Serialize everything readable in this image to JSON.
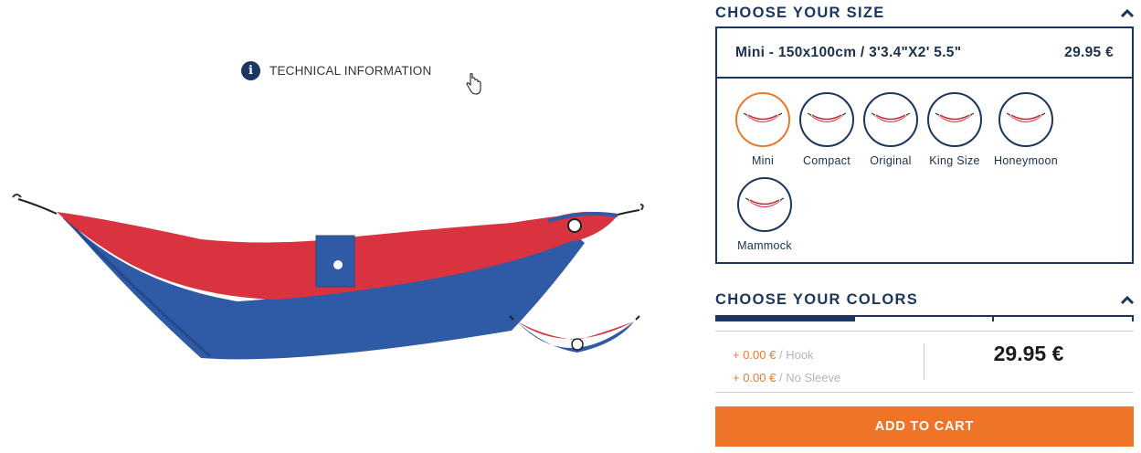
{
  "tech_info": {
    "label": "TECHNICAL INFORMATION",
    "icon": "info-icon"
  },
  "size_section": {
    "title": "CHOOSE YOUR SIZE",
    "selected": {
      "name": "Mini - 150x100cm / 3'3.4\"X2' 5.5\"",
      "price": "29.95 €"
    },
    "options": [
      {
        "label": "Mini",
        "selected": true
      },
      {
        "label": "Compact",
        "selected": false
      },
      {
        "label": "Original",
        "selected": false
      },
      {
        "label": "King Size",
        "selected": false
      },
      {
        "label": "Honeymoon",
        "selected": false
      },
      {
        "label": "Mammock",
        "selected": false
      }
    ]
  },
  "colors_section": {
    "title": "CHOOSE YOUR COLORS",
    "extras": [
      {
        "price": "+ 0.00 €",
        "label": "/ Hook"
      },
      {
        "price": "+ 0.00 €",
        "label": "/ No Sleeve"
      }
    ],
    "total": "29.95 €"
  },
  "cart_button": "ADD TO CART",
  "colors": {
    "navy": "#1b3660",
    "orange": "#ee7428",
    "hammock_red": "#d8333f",
    "hammock_blue": "#2f5aa6"
  }
}
